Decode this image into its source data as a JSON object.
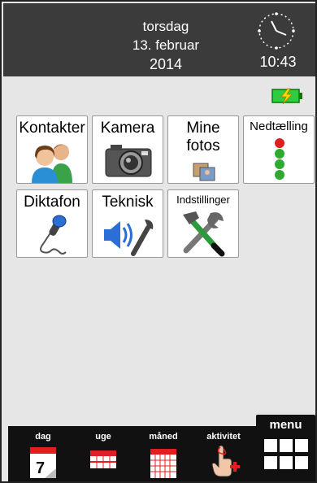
{
  "header": {
    "weekday": "torsdag",
    "date": "13. februar",
    "year": "2014",
    "time": "10:43"
  },
  "status": {
    "battery_color": "#33cc33",
    "battery_charging": true
  },
  "apps": [
    {
      "label": "Kontakter",
      "icon": "contacts-icon"
    },
    {
      "label": "Kamera",
      "icon": "camera-icon"
    },
    {
      "label": "Mine fotos",
      "line1": "Mine",
      "line2": "fotos",
      "icon": "photos-icon"
    },
    {
      "label": "Nedtælling",
      "icon": "traffic-light-icon"
    },
    {
      "label": "Diktafon",
      "icon": "microphone-icon"
    },
    {
      "label": "Teknisk",
      "icon": "speaker-wrench-icon"
    },
    {
      "label": "Indstillinger",
      "icon": "tools-icon"
    }
  ],
  "bottom_nav": [
    {
      "label": "dag",
      "icon": "calendar-day-icon"
    },
    {
      "label": "uge",
      "icon": "calendar-week-icon"
    },
    {
      "label": "måned",
      "icon": "calendar-month-icon"
    },
    {
      "label": "aktivitet",
      "icon": "activity-add-icon"
    }
  ],
  "menu": {
    "label": "menu",
    "icon": "grid-menu-icon"
  }
}
